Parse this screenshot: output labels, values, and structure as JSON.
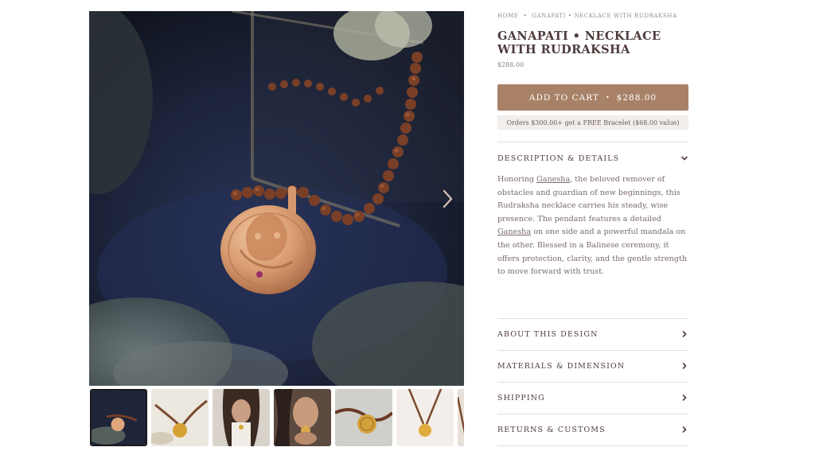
{
  "breadcrumb": {
    "home": "HOME",
    "separator": "•",
    "current": "GANAPATI • NECKLACE WITH RUDRAKSHA"
  },
  "product": {
    "title": "GANAPATI • NECKLACE WITH RUDRAKSHA",
    "price": "$288.00"
  },
  "cart": {
    "label": "ADD TO CART",
    "separator": "•",
    "price": "$288.00"
  },
  "promo": {
    "text": "Orders $300.00+ get a FREE Bracelet ($68.00 value)"
  },
  "description": {
    "heading": "DESCRIPTION & DETAILS",
    "expanded": true,
    "text_1": "Honoring ",
    "link_1": "Ganesha",
    "text_2": ", the beloved remover of obstacles and guardian of new beginnings, this Rudraksha necklace carries his steady, wise presence. The pendant features a detailed ",
    "link_2": "Ganesha",
    "text_3": " on one side and a powerful mandala on the other. Blessed in a Balinese ceremony, it offers protection, clarity, and the gentle strength to move forward with trust."
  },
  "accordion": [
    {
      "label": "ABOUT THIS DESIGN"
    },
    {
      "label": "MATERIALS & DIMENSION"
    },
    {
      "label": "SHIPPING"
    },
    {
      "label": "RETURNS & CUSTOMS"
    }
  ],
  "gallery": {
    "thumbnails": [
      {
        "name": "thumb-pendant-dark"
      },
      {
        "name": "thumb-necklace-flatlay"
      },
      {
        "name": "thumb-model-wearing"
      },
      {
        "name": "thumb-model-holding"
      },
      {
        "name": "thumb-necklace-closeup"
      },
      {
        "name": "thumb-necklace-white"
      },
      {
        "name": "thumb-partial"
      }
    ],
    "active_index": 0
  },
  "colors": {
    "button": "#a88167",
    "title": "#4e3b3c",
    "promo_bg": "#f2eeeb",
    "body_text": "#7a6a6a"
  },
  "icons": {
    "next": "chevron-right-icon",
    "expanded": "chevron-down-icon",
    "collapsed": "chevron-right-icon"
  }
}
